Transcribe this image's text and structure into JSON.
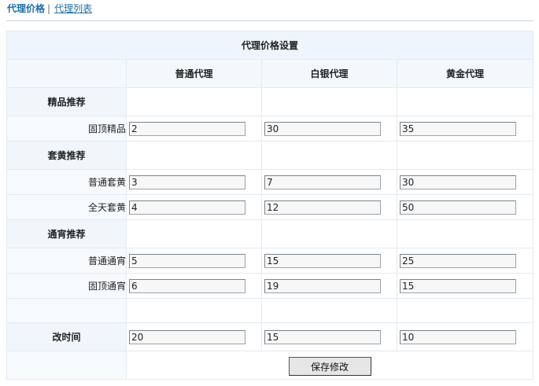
{
  "nav": {
    "active": "代理价格",
    "link": "代理列表"
  },
  "table": {
    "title": "代理价格设置",
    "columns": [
      "普通代理",
      "白银代理",
      "黄金代理"
    ],
    "sections": [
      {
        "name": "精品推荐",
        "rows": [
          {
            "label": "固顶精品",
            "values": [
              "2",
              "30",
              "35"
            ]
          }
        ]
      },
      {
        "name": "套黄推荐",
        "rows": [
          {
            "label": "普通套黄",
            "values": [
              "3",
              "7",
              "30"
            ]
          },
          {
            "label": "全天套黄",
            "values": [
              "4",
              "12",
              "50"
            ]
          }
        ]
      },
      {
        "name": "通宵推荐",
        "rows": [
          {
            "label": "普通通宵",
            "values": [
              "5",
              "15",
              "25"
            ]
          },
          {
            "label": "固顶通宵",
            "values": [
              "6",
              "19",
              "15"
            ]
          }
        ]
      }
    ],
    "time_row": {
      "label": "改时间",
      "values": [
        "20",
        "15",
        "10"
      ]
    },
    "save_label": "保存修改"
  }
}
